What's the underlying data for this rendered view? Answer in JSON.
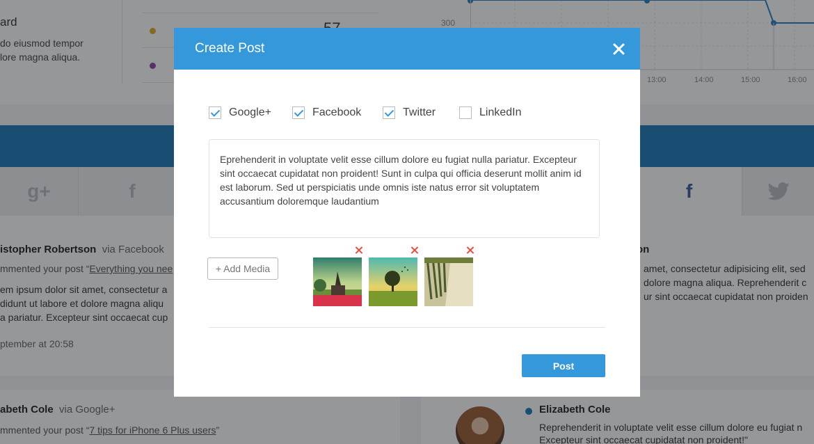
{
  "modal": {
    "title": "Create Post",
    "networks": [
      {
        "label": "Google+",
        "checked": true
      },
      {
        "label": "Facebook",
        "checked": true
      },
      {
        "label": "Twitter",
        "checked": true
      },
      {
        "label": "LinkedIn",
        "checked": false
      }
    ],
    "post_text": "Eprehenderit in voluptate velit esse cillum dolore eu fugiat nulla pariatur. Excepteur sint occaecat cupidatat non proident! Sunt in culpa qui officia deserunt mollit anim id est laborum. Sed ut perspiciatis unde omnis iste natus error sit voluptatem accusantium doloremque laudantium",
    "add_media_label": "+ Add Media",
    "post_button_label": "Post",
    "media_count": 3
  },
  "background": {
    "card_title": "ard",
    "card_desc_1": "do eiusmod tempor",
    "card_desc_2": "lore magna aliqua.",
    "stat_value": "57",
    "chart_y_label": "300",
    "chart_ticks": [
      "13:00",
      "14:00",
      "15:00",
      "16:00"
    ],
    "feed1": {
      "name": "istopher Robertson",
      "via": "via Facebook",
      "commented_prefix": "mmented your post “",
      "commented_link": "Everything you nee",
      "line1": "em ipsum dolor sit amet, consectetur a",
      "line2": "didunt ut labore et dolore magna aliqu",
      "line3": "a pariatur. Excepteur sint occaecat cup",
      "time": "ptember at 20:58"
    },
    "feed_right": {
      "name": "on",
      "line1": "amet, consectetur adipisicing elit, sed",
      "line2": "dolore magna aliqua. Reprehenderit c",
      "line3": "ur sint occaecat cupidatat non proiden"
    },
    "feed2": {
      "name": "abeth Cole",
      "via": "via Google+",
      "commented_prefix": "mmented your post “",
      "commented_link": "7 tips for iPhone 6 Plus users",
      "commented_suffix": "”"
    },
    "feed_right2": {
      "name": "Elizabeth Cole",
      "line1": "Reprehenderit in voluptate velit esse cillum dolore eu fugiat n",
      "line2": "Excepteur sint occaecat cupidatat non proident!\""
    }
  },
  "colors": {
    "accent": "#3498db",
    "remove": "#e84c3d",
    "band": "#1e78b8"
  },
  "icons": [
    "close-icon",
    "checkmark-icon",
    "remove-icon",
    "google-plus-icon",
    "facebook-icon",
    "twitter-icon"
  ]
}
